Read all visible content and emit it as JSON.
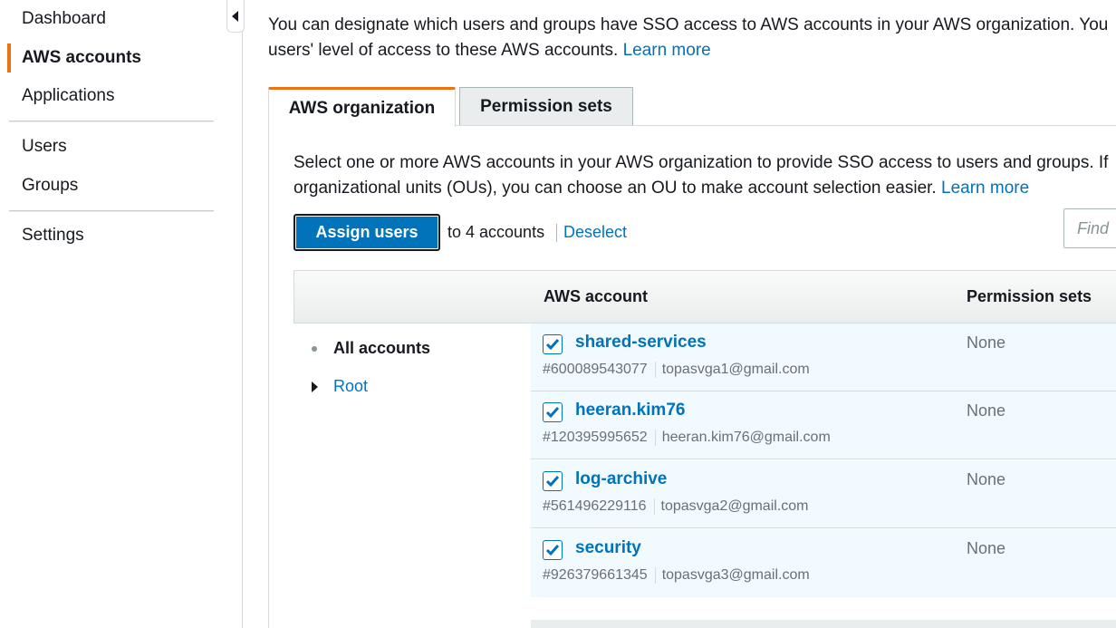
{
  "sidebar": {
    "items_top": [
      "Dashboard",
      "AWS accounts",
      "Applications"
    ],
    "items_mid": [
      "Users",
      "Groups"
    ],
    "items_bottom": [
      "Settings"
    ],
    "active": "AWS accounts"
  },
  "intro": {
    "line1": "You can designate which users and groups have SSO access to AWS accounts in your AWS organization. You",
    "line2_prefix": "users' level of access to these AWS accounts.",
    "learn_more": "Learn more"
  },
  "tabs": [
    {
      "label": "AWS organization",
      "active": true
    },
    {
      "label": "Permission sets",
      "active": false
    }
  ],
  "panel": {
    "line1": "Select one or more AWS accounts in your AWS organization to provide SSO access to users and groups. If",
    "line2_prefix": "organizational units (OUs), you can choose an OU to make account selection easier.",
    "learn_more": "Learn more"
  },
  "actions": {
    "assign_button": "Assign users",
    "count_text": "to 4 accounts",
    "deselect": "Deselect",
    "find_placeholder": "Find"
  },
  "table": {
    "columns": [
      "AWS account",
      "Permission sets"
    ],
    "tree": {
      "all_accounts": "All accounts",
      "root": "Root"
    },
    "rows": [
      {
        "name": "shared-services",
        "id": "#600089543077",
        "email": "topasvga1@gmail.com",
        "permission_sets": "None",
        "checked": true
      },
      {
        "name": "heeran.kim76",
        "id": "#120395995652",
        "email": "heeran.kim76@gmail.com",
        "permission_sets": "None",
        "checked": true
      },
      {
        "name": "log-archive",
        "id": "#561496229116",
        "email": "topasvga2@gmail.com",
        "permission_sets": "None",
        "checked": true
      },
      {
        "name": "security",
        "id": "#926379661345",
        "email": "topasvga3@gmail.com",
        "permission_sets": "None",
        "checked": true
      }
    ]
  },
  "colors": {
    "accent": "#ec7211",
    "link": "#0073bb",
    "row_selected": "#f1faff"
  }
}
